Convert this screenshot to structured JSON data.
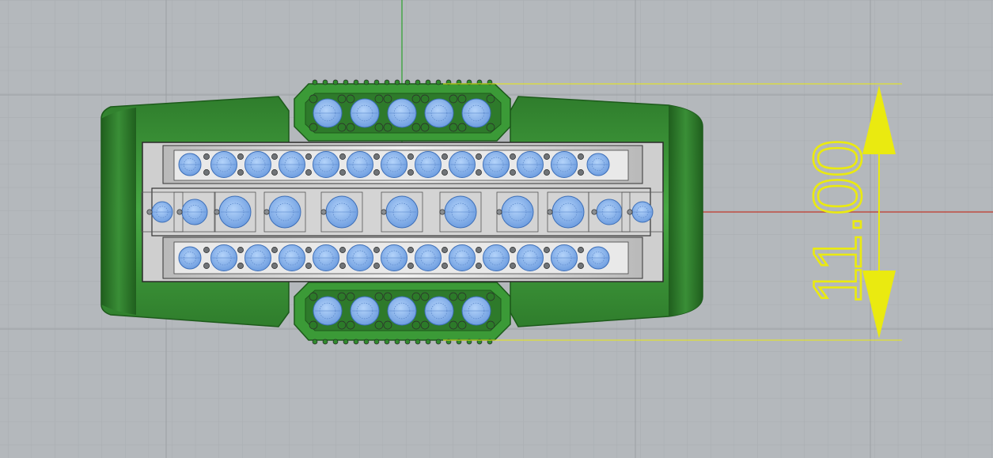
{
  "viewport": {
    "dimension_value": "11.00",
    "colors": {
      "background": "#b4b8bc",
      "grid_minor": "#a8acb0",
      "grid_major": "#9a9ea2",
      "axis_x": "#c0392b",
      "axis_y": "#2ca02c",
      "dimension": "#eaea10",
      "ring_body": "#3e9a3a",
      "ring_dark": "#1f5e1c",
      "gem": "#8ab8f0",
      "gem_mesh": "#5a86c8",
      "prong": "#6a6e72",
      "setting_frame": "#d8d8d8"
    },
    "icons": {
      "dimension_arrow_up": "triangle-up-icon",
      "dimension_arrow_down": "triangle-down-icon"
    }
  }
}
